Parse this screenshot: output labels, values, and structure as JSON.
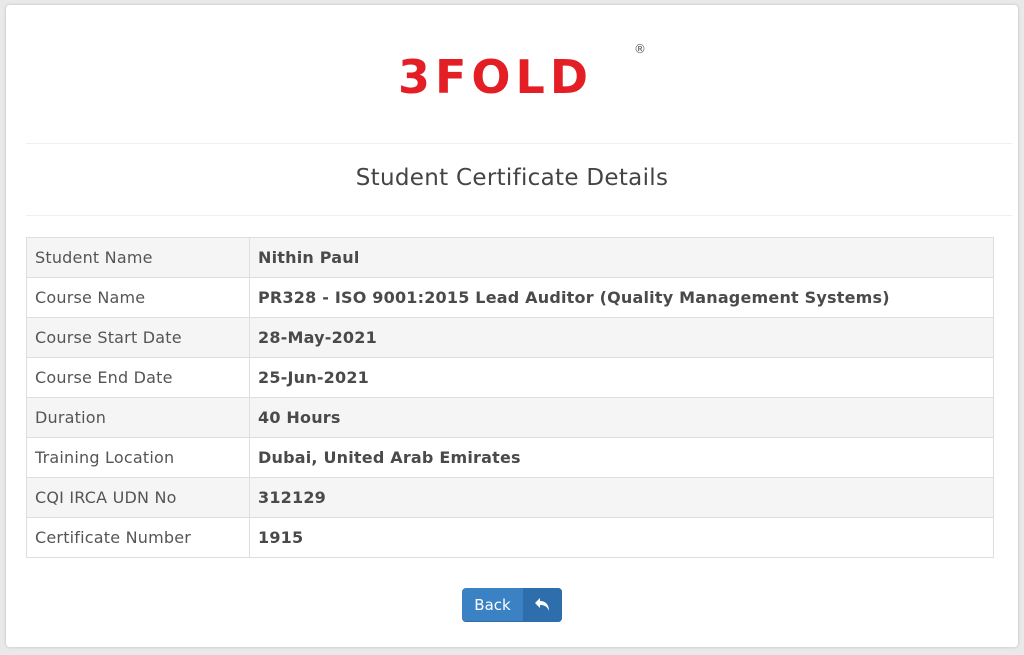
{
  "brand": {
    "name": "3FOLD",
    "registered_mark": "®",
    "color": "#e31e24"
  },
  "page_title": "Student Certificate Details",
  "details": [
    {
      "label": "Student Name",
      "value": "Nithin Paul"
    },
    {
      "label": "Course Name",
      "value": "PR328 - ISO 9001:2015 Lead Auditor (Quality Management Systems)"
    },
    {
      "label": "Course Start Date",
      "value": "28-May-2021"
    },
    {
      "label": "Course End Date",
      "value": "25-Jun-2021"
    },
    {
      "label": "Duration",
      "value": "40 Hours"
    },
    {
      "label": "Training Location",
      "value": "Dubai, United Arab Emirates"
    },
    {
      "label": "CQI IRCA UDN No",
      "value": "312129"
    },
    {
      "label": "Certificate Number",
      "value": "1915"
    }
  ],
  "back_button": {
    "label": "Back",
    "icon": "reply-arrow-icon",
    "color": "#3b82c4"
  }
}
